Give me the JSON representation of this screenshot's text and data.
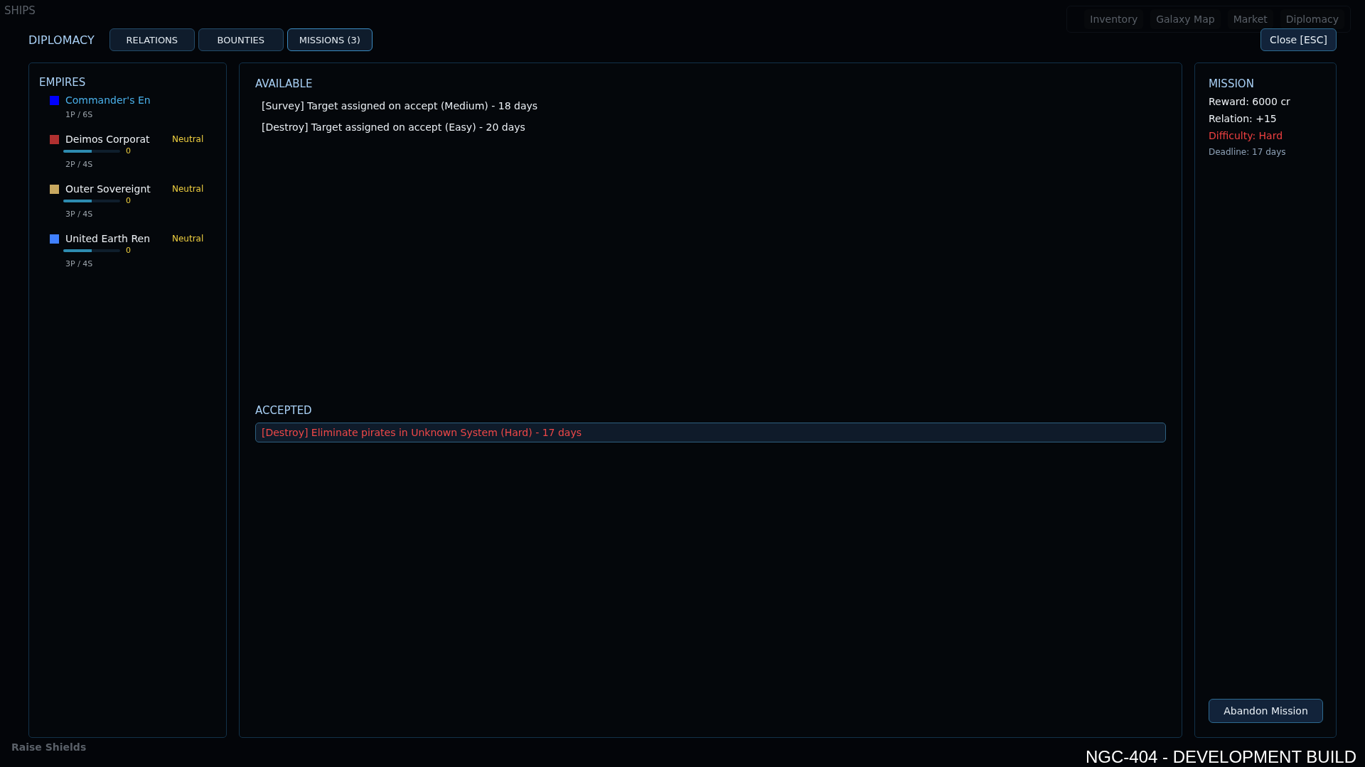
{
  "background": {
    "section_title": "SHIPS",
    "nav": [
      "Inventory",
      "Galaxy Map",
      "Market",
      "Diplomacy"
    ],
    "action": "Raise Shields"
  },
  "header": {
    "title": "DIPLOMACY",
    "tabs": [
      {
        "label": "RELATIONS",
        "selected": false
      },
      {
        "label": "BOUNTIES",
        "selected": false
      },
      {
        "label": "MISSIONS (3)",
        "selected": true
      }
    ],
    "close_button": "Close [ESC]"
  },
  "empires": {
    "title": "EMPIRES",
    "items": [
      {
        "name": "Commander's En",
        "color": "#0000ff",
        "selected": true,
        "stats": "1P / 6S"
      },
      {
        "name": "Deimos Corporat",
        "color": "#b03030",
        "selected": false,
        "status": "Neutral",
        "level": 0.5,
        "reading": "0",
        "stats": "2P / 4S"
      },
      {
        "name": "Outer Sovereignt",
        "color": "#c8a860",
        "selected": false,
        "status": "Neutral",
        "level": 0.5,
        "reading": "0",
        "stats": "3P / 4S"
      },
      {
        "name": "United Earth Ren",
        "color": "#4080ff",
        "selected": false,
        "status": "Neutral",
        "level": 0.5,
        "reading": "0",
        "stats": "3P / 4S"
      }
    ]
  },
  "missions": {
    "available_title": "AVAILABLE",
    "available": [
      {
        "text": "[Survey] Target assigned on accept (Medium) - 18 days",
        "selected": false
      },
      {
        "text": "[Destroy] Target assigned on accept (Easy) - 20 days",
        "selected": false
      }
    ],
    "accepted_title": "ACCEPTED",
    "accepted": [
      {
        "text": "[Destroy] Eliminate pirates in Unknown System (Hard) - 17 days",
        "selected": true
      }
    ]
  },
  "mission_detail": {
    "title": "MISSION",
    "lines": [
      {
        "kind": "normal",
        "text": "Reward: 6000 cr"
      },
      {
        "kind": "normal",
        "text": "Relation: +15"
      },
      {
        "kind": "danger",
        "text": "Difficulty: Hard"
      },
      {
        "kind": "note",
        "text": "Deadline: 17 days"
      }
    ],
    "abandon_button": "Abandon Mission"
  },
  "build_label": "NGC-404 - DEVELOPMENT BUILD"
}
